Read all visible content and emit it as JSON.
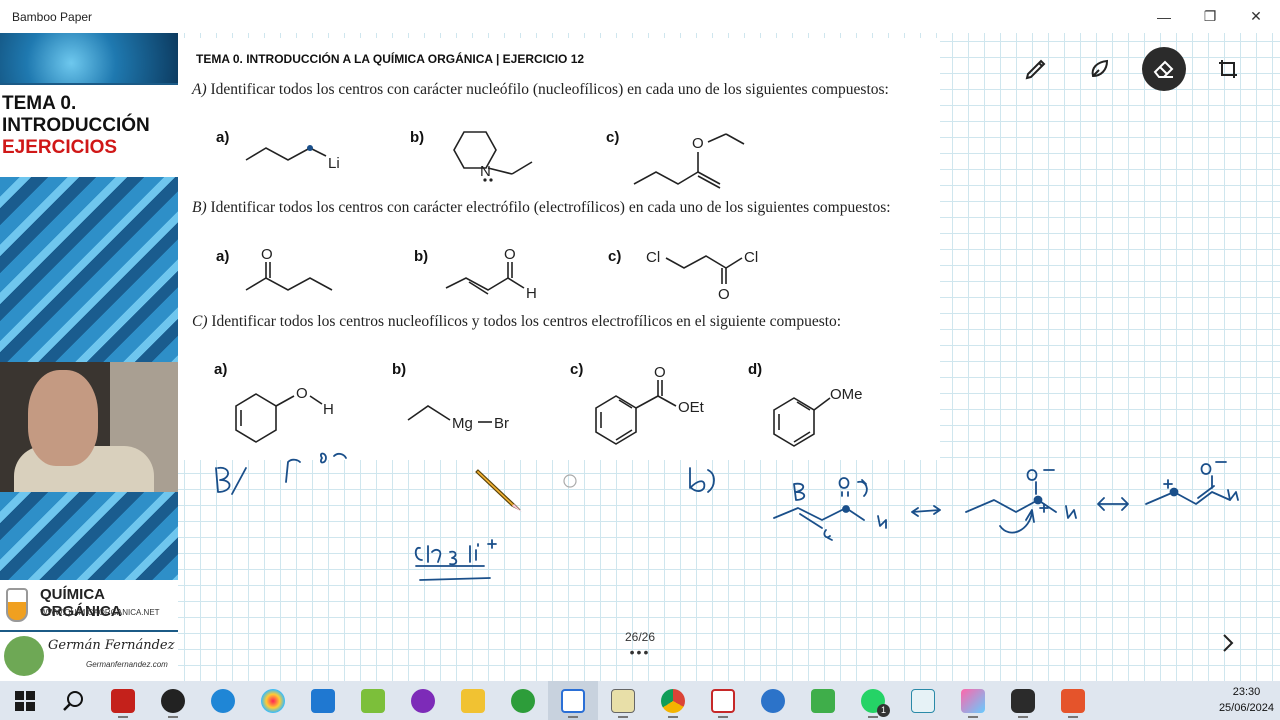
{
  "window": {
    "title": "Bamboo Paper",
    "minimize_label": "—",
    "restore_label": "❐",
    "close_label": "✕"
  },
  "sidebar": {
    "title_line1": "TEMA 0.",
    "title_line2": "INTRODUCCIÓN",
    "title_line3": "EJERCICIOS",
    "brand_title": "QUÍMICA ORGÁNICA",
    "brand_url": "WWW.QUIMICAORGANICA.NET",
    "author_name": "Germán Fernández",
    "author_site": "Germanfernandez.com"
  },
  "sheet": {
    "header": "TEMA 0. INTRODUCCIÓN A LA QUÍMICA ORGÁNICA | EJERCICIO 12",
    "question_a_letter": "A)",
    "question_a_text": " Identificar todos los centros con carácter nucleófilo (nucleofílicos) en cada uno de los siguientes compuestos:",
    "question_b_letter": "B)",
    "question_b_text": " Identificar todos los centros con carácter electrófilo (electrofílicos) en cada uno de los siguientes compuestos:",
    "question_c_letter": "C)",
    "question_c_text": " Identificar todos los centros nucleofílicos y todos los centros electrofílicos en el siguiente compuesto:",
    "labels": {
      "a": "a)",
      "b": "b)",
      "c": "c)",
      "d": "d)"
    },
    "atoms": {
      "li": "Li",
      "n": "N",
      "o": "O",
      "h": "H",
      "cl": "Cl",
      "mgbr_mg": "Mg",
      "mgbr_br": "Br",
      "oet": "OEt",
      "ome": "OMe"
    }
  },
  "toolbar": {
    "icons": [
      "pen-icon",
      "highlighter-icon",
      "eraser-icon",
      "crop-icon"
    ],
    "active": "eraser-icon",
    "active_bg": "#2b2b2b"
  },
  "page_indicator": "26/26",
  "page_dots": "•••",
  "handwriting_labels": {
    "note_b": "B/",
    "note_b2": "b)",
    "note_ch3li": "CH₃ Li⁺"
  },
  "taskbar": {
    "apps": [
      "start-icon",
      "search-icon",
      "filezilla-icon",
      "media-player-icon",
      "messenger-icon",
      "paint-icon",
      "mail-icon",
      "notepad-icon",
      "3d-viewer-icon",
      "file-explorer-icon",
      "cd-burner-icon",
      "bamboo-paper-icon",
      "chemdraw-icon",
      "chrome-icon",
      "pdf-icon",
      "thunderbird-icon",
      "camtasia-icon",
      "whatsapp-icon",
      "app-icon",
      "paint3d-icon",
      "obs-icon",
      "screen-recorder-icon"
    ],
    "whatsapp_badge": "1",
    "time": "23:30",
    "date": "25/06/2024"
  },
  "colors": {
    "ink": "#1a4f8a",
    "grid": "#cfe6ee",
    "sidebar_blue": "#1b5a86",
    "accent_red": "#d01818"
  }
}
